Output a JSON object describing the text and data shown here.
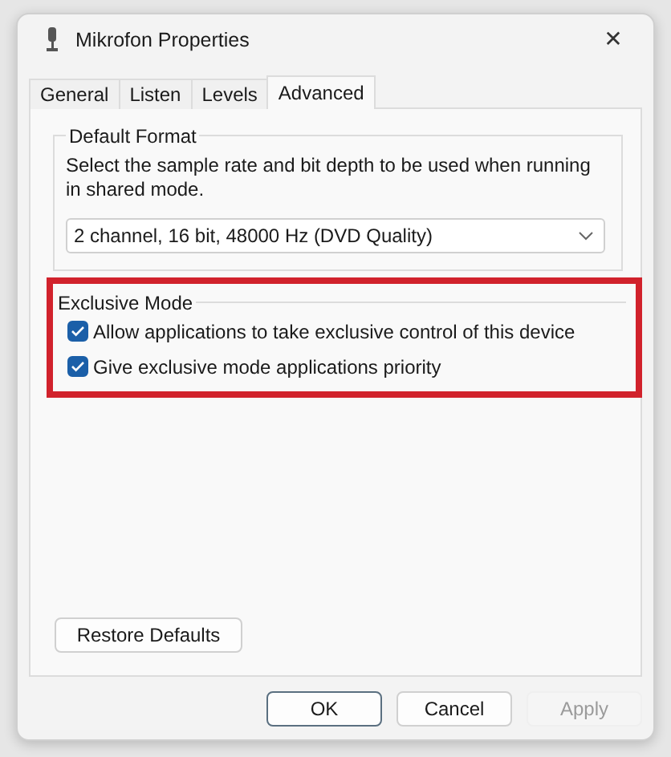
{
  "window": {
    "title": "Mikrofon Properties",
    "close_glyph": "✕"
  },
  "tabs": [
    {
      "label": "General",
      "selected": false
    },
    {
      "label": "Listen",
      "selected": false
    },
    {
      "label": "Levels",
      "selected": false
    },
    {
      "label": "Advanced",
      "selected": true
    }
  ],
  "default_format": {
    "legend": "Default Format",
    "description": "Select the sample rate and bit depth to be used when running in shared mode.",
    "dropdown_value": "2 channel, 16 bit, 48000 Hz (DVD Quality)"
  },
  "exclusive_mode": {
    "legend": "Exclusive Mode",
    "highlighted": true,
    "options": [
      {
        "label": "Allow applications to take exclusive control of this device",
        "checked": true
      },
      {
        "label": "Give exclusive mode applications priority",
        "checked": true
      }
    ]
  },
  "restore_button": "Restore Defaults",
  "buttons": [
    {
      "label": "OK",
      "kind": "default",
      "disabled": false
    },
    {
      "label": "Cancel",
      "kind": "normal",
      "disabled": false
    },
    {
      "label": "Apply",
      "kind": "normal",
      "disabled": true
    }
  ]
}
